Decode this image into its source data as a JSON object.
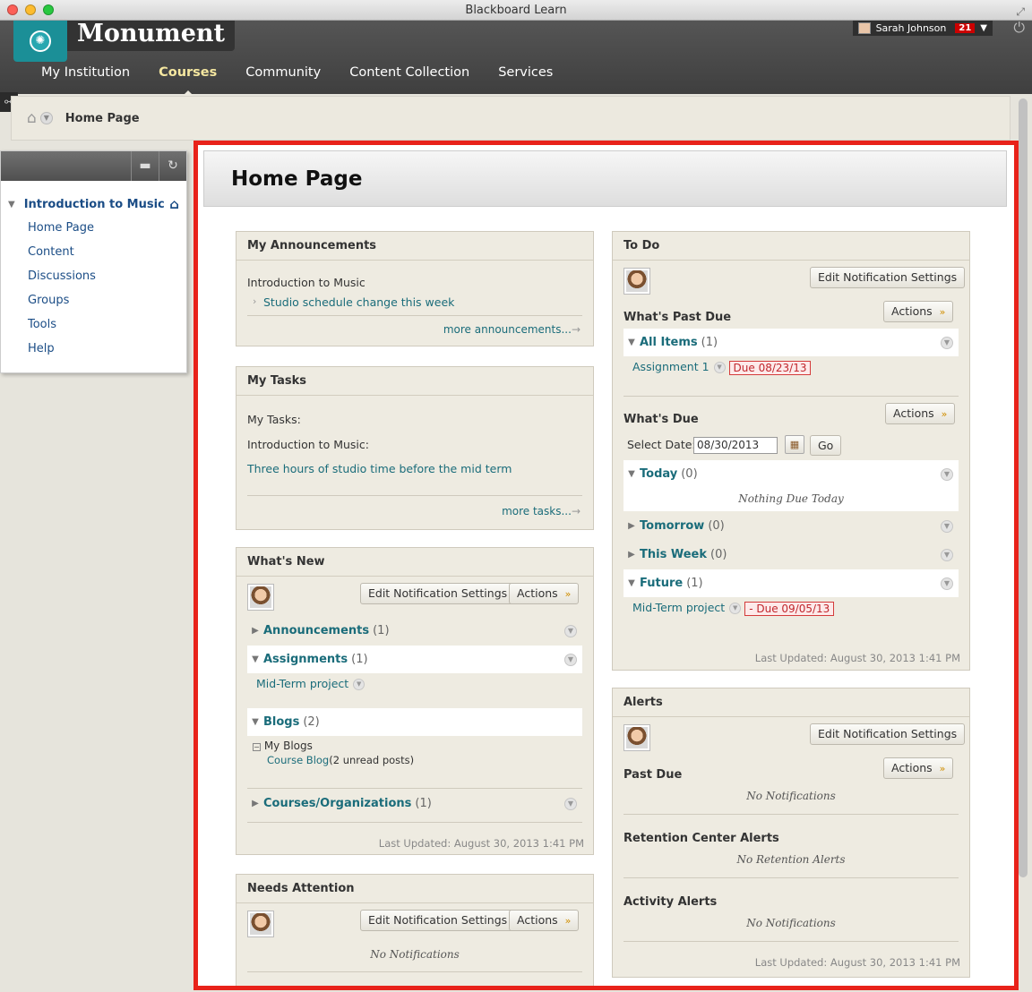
{
  "window": {
    "title": "Blackboard Learn"
  },
  "header": {
    "brand": "Monument",
    "tabs": [
      "My Institution",
      "Courses",
      "Community",
      "Content Collection",
      "Services"
    ],
    "user_name": "Sarah Johnson",
    "notification_count": "21"
  },
  "breadcrumb": {
    "current": "Home Page"
  },
  "course_menu": {
    "course": "Introduction to Music",
    "items": [
      "Home Page",
      "Content",
      "Discussions",
      "Groups",
      "Tools",
      "Help"
    ]
  },
  "page": {
    "title": "Home Page"
  },
  "announcements": {
    "title": "My Announcements",
    "course": "Introduction to Music",
    "item": "Studio schedule change this week",
    "more": "more announcements..."
  },
  "tasks": {
    "title": "My Tasks",
    "label": "My Tasks:",
    "course": "Introduction to Music:",
    "item": "Three hours of studio time before the mid term",
    "more": "more tasks..."
  },
  "whats_new": {
    "title": "What's New",
    "edit_btn": "Edit Notification Settings",
    "actions_btn": "Actions",
    "rows": [
      {
        "name": "Announcements",
        "count": "(1)"
      },
      {
        "name": "Assignments",
        "count": "(1)"
      },
      {
        "name": "Blogs",
        "count": "(2)"
      },
      {
        "name": "Courses/Organizations",
        "count": "(1)"
      }
    ],
    "assignment_item": "Mid-Term project",
    "blogs_header": "My Blogs",
    "blog_link": "Course Blog",
    "blog_suffix": "(2 unread posts)",
    "last_updated": "Last Updated: August 30, 2013 1:41 PM"
  },
  "needs_attention": {
    "title": "Needs Attention",
    "edit_btn": "Edit Notification Settings",
    "actions_btn": "Actions",
    "empty": "No Notifications"
  },
  "todo": {
    "title": "To Do",
    "edit_btn": "Edit Notification Settings",
    "past_due_label": "What's Past Due",
    "actions_btn": "Actions",
    "all_items": {
      "name": "All Items",
      "count": "(1)"
    },
    "past_item": "Assignment 1",
    "past_due": "Due 08/23/13",
    "whats_due_label": "What's Due",
    "select_date_label": "Select Date:",
    "date_value": "08/30/2013",
    "go_btn": "Go",
    "today": {
      "name": "Today",
      "count": "(0)"
    },
    "today_empty": "Nothing Due Today",
    "tomorrow": {
      "name": "Tomorrow",
      "count": "(0)"
    },
    "this_week": {
      "name": "This Week",
      "count": "(0)"
    },
    "future": {
      "name": "Future",
      "count": "(1)"
    },
    "future_item": "Mid-Term project",
    "future_due": "- Due 09/05/13",
    "last_updated": "Last Updated: August 30, 2013 1:41 PM"
  },
  "alerts": {
    "title": "Alerts",
    "edit_btn": "Edit Notification Settings",
    "past_due_label": "Past Due",
    "actions_btn": "Actions",
    "past_due_empty": "No Notifications",
    "retention_label": "Retention Center Alerts",
    "retention_empty": "No Retention Alerts",
    "activity_label": "Activity Alerts",
    "activity_empty": "No Notifications",
    "last_updated": "Last Updated: August 30, 2013 1:41 PM"
  },
  "colors": {
    "accent": "#1a6c7a",
    "highlight_frame": "#e8221a",
    "nav_active": "#f5e7a0",
    "due_red": "#c1272d"
  }
}
